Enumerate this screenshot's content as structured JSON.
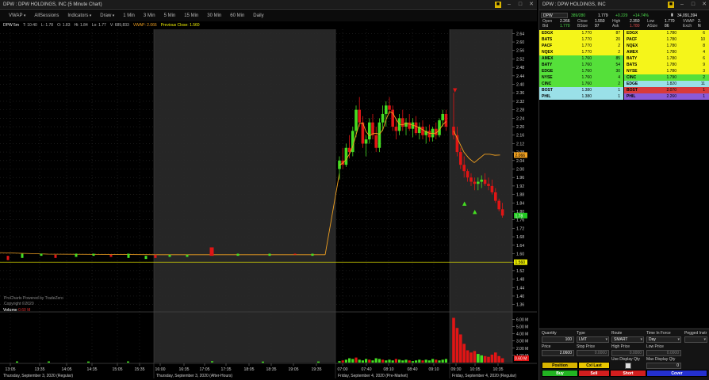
{
  "chart": {
    "title": "DPW : DPW HOLDINGS, INC (5 Minute Chart)",
    "toolbar": [
      "VWAP",
      "AllSessions",
      "Indicators",
      "Draw",
      "1 Min",
      "3 Min",
      "5 Min",
      "15 Min",
      "30 Min",
      "60 Min",
      "Daily"
    ],
    "info": {
      "symbol": "DPW 5m",
      "t": "T: 10:40",
      "l": "L: 1.78",
      "o": "O: 1.83",
      "hi": "Hi: 1.84",
      "lo": "Lo: 1.77",
      "v": "V: 689,833",
      "vwap": "VWAP: 2.066",
      "prev_close": "Previous Close: 1.560"
    },
    "watermark": [
      "ProCharts Powered by TradeZero",
      "Copyright ©2020"
    ],
    "volume_title": "Volume",
    "volume_value": "0.60 M",
    "colors": {
      "up": "#44dd22",
      "down": "#e01515",
      "vwap": "#f0a020",
      "prev_close": "#e8e800",
      "shade": "#262626"
    }
  },
  "chart_data": {
    "type": "candlestick",
    "price_ticks": [
      "2.64",
      "2.60",
      "2.56",
      "2.52",
      "2.48",
      "2.44",
      "2.40",
      "2.36",
      "2.32",
      "2.28",
      "2.24",
      "2.20",
      "2.16",
      "2.12",
      "2.08",
      "2.04",
      "2.00",
      "1.96",
      "1.92",
      "1.88",
      "1.84",
      "1.80",
      "1.76",
      "1.72",
      "1.68",
      "1.64",
      "1.60",
      "1.56",
      "1.52",
      "1.48",
      "1.44",
      "1.40",
      "1.36"
    ],
    "ylim": [
      1.34,
      2.66
    ],
    "volume_ticks": [
      "6.00 M",
      "5.00 M",
      "4.00 M",
      "3.00 M",
      "2.00 M",
      "1.00 M"
    ],
    "volume_ylim": [
      0,
      6.8
    ],
    "time_ticks": [
      "13:05",
      "13:35",
      "14:05",
      "14:35",
      "15:05",
      "15:35",
      "16:00",
      "16:35",
      "17:05",
      "17:35",
      "18:05",
      "18:35",
      "19:05",
      "19:35",
      "07:00",
      "07:40",
      "08:10",
      "08:40",
      "09:10",
      "09:30",
      "10:05",
      "10:35"
    ],
    "sessions": [
      "Thursday, September 3, 2020 (Regular)",
      "Thursday, September 3, 2020 (After-Hours)",
      "Friday, September 4, 2020 (Pre-Market)",
      "Friday, September 4, 2020 (Regular)"
    ],
    "price_markers": {
      "vwap": "2.066",
      "last": "1.78",
      "prev_close": "1.560"
    },
    "prev_close": 1.56,
    "candles_pre": [
      [
        2.0,
        2.06,
        1.95,
        2.04
      ],
      [
        2.04,
        2.1,
        2.0,
        2.02
      ],
      [
        2.02,
        2.12,
        2.01,
        2.1
      ],
      [
        2.1,
        2.16,
        2.05,
        2.08
      ],
      [
        2.08,
        2.2,
        2.06,
        2.18
      ],
      [
        2.18,
        2.3,
        2.15,
        2.28
      ],
      [
        2.28,
        2.34,
        2.2,
        2.22
      ],
      [
        2.22,
        2.25,
        2.1,
        2.12
      ],
      [
        2.12,
        2.16,
        2.06,
        2.14
      ],
      [
        2.14,
        2.24,
        2.12,
        2.22
      ],
      [
        2.22,
        2.26,
        2.14,
        2.16
      ],
      [
        2.16,
        2.2,
        2.08,
        2.1
      ],
      [
        2.1,
        2.24,
        2.08,
        2.22
      ],
      [
        2.22,
        2.3,
        2.18,
        2.26
      ],
      [
        2.26,
        2.32,
        2.2,
        2.3
      ],
      [
        2.3,
        2.34,
        2.26,
        2.28
      ],
      [
        2.28,
        2.3,
        2.18,
        2.2
      ],
      [
        2.2,
        2.24,
        2.14,
        2.18
      ],
      [
        2.18,
        2.26,
        2.16,
        2.24
      ],
      [
        2.24,
        2.28,
        2.18,
        2.2
      ],
      [
        2.2,
        2.24,
        2.16,
        2.22
      ],
      [
        2.22,
        2.26,
        2.18,
        2.19
      ],
      [
        2.19,
        2.24,
        2.15,
        2.22
      ],
      [
        2.22,
        2.25,
        2.16,
        2.17
      ],
      [
        2.17,
        2.22,
        2.14,
        2.2
      ],
      [
        2.2,
        2.23,
        2.14,
        2.16
      ],
      [
        2.16,
        2.2,
        2.12,
        2.18
      ],
      [
        2.18,
        2.21,
        2.13,
        2.15
      ],
      [
        2.15,
        2.2,
        2.13,
        2.19
      ],
      [
        2.19,
        2.22,
        2.14,
        2.16
      ],
      [
        2.16,
        2.24,
        2.15,
        2.23
      ],
      [
        2.23,
        2.28,
        2.2,
        2.26
      ],
      [
        2.26,
        2.28,
        2.18,
        2.2
      ]
    ],
    "candles_regular": [
      [
        2.2,
        2.36,
        2.14,
        2.16
      ],
      [
        2.16,
        2.2,
        2.06,
        2.08
      ],
      [
        2.08,
        2.1,
        2.0,
        2.02
      ],
      [
        2.02,
        2.06,
        1.96,
        1.99
      ],
      [
        1.99,
        2.0,
        1.94,
        1.96
      ],
      [
        1.96,
        1.98,
        1.92,
        1.94
      ],
      [
        1.94,
        1.96,
        1.9,
        1.93
      ],
      [
        1.93,
        1.96,
        1.9,
        1.94
      ],
      [
        1.94,
        1.97,
        1.91,
        1.95
      ],
      [
        1.95,
        1.98,
        1.92,
        1.93
      ],
      [
        1.93,
        1.96,
        1.9,
        1.92
      ],
      [
        1.92,
        1.95,
        1.88,
        1.89
      ],
      [
        1.89,
        1.91,
        1.84,
        1.85
      ],
      [
        1.85,
        1.86,
        1.8,
        1.81
      ],
      [
        1.81,
        1.84,
        1.77,
        1.78
      ]
    ],
    "volume_pre": [
      0.2,
      0.3,
      0.4,
      0.6,
      0.5,
      0.7,
      0.4,
      0.3,
      0.5,
      0.4,
      0.3,
      0.6,
      0.5,
      0.4,
      0.3,
      0.4,
      0.3,
      0.5,
      0.4,
      0.3,
      0.4,
      0.3,
      0.2,
      0.3,
      0.4,
      0.3,
      0.4,
      0.3,
      0.5,
      0.4,
      0.3,
      0.4,
      0.5
    ],
    "volume_regular": [
      6.2,
      4.8,
      3.9,
      2.6,
      1.7,
      1.4,
      1.6,
      1.2,
      1.0,
      0.9,
      0.8,
      1.1,
      1.4,
      0.9,
      0.6
    ]
  },
  "level2": {
    "title": "DPW : DPW HOLDINGS, INC",
    "symbol": "DPW",
    "range": "389/280",
    "last": "1.779",
    "change": "+0.229",
    "change_pct": "+14.74%",
    "volume": "34,091,394",
    "header": [
      [
        "Open",
        "2.266",
        "Close",
        "1.550",
        "High",
        "2.350",
        "Low",
        "1.770",
        "VWAP",
        "2."
      ],
      [
        "Bid",
        "1.770",
        "BSize",
        "97",
        "Ask",
        "1.780",
        "ASize",
        "86",
        "Exch",
        "N"
      ]
    ],
    "rows": [
      {
        "bmm": "EDGX",
        "bpx": "1.770",
        "bsz": "87",
        "amm": "EDGX",
        "apx": "1.780",
        "asz": "6",
        "bc": "#f5f51a",
        "ac": "#f5f51a"
      },
      {
        "bmm": "BATS",
        "bpx": "1.770",
        "bsz": "20",
        "amm": "PACF",
        "apx": "1.780",
        "asz": "10",
        "bc": "#f5f51a",
        "ac": "#f5f51a"
      },
      {
        "bmm": "PACF",
        "bpx": "1.770",
        "bsz": "2",
        "amm": "NQEX",
        "apx": "1.780",
        "asz": "8",
        "bc": "#f5f51a",
        "ac": "#f5f51a"
      },
      {
        "bmm": "NQEX",
        "bpx": "1.770",
        "bsz": "2",
        "amm": "AMEX",
        "apx": "1.780",
        "asz": "4",
        "bc": "#f5f51a",
        "ac": "#f5f51a"
      },
      {
        "bmm": "AMEX",
        "bpx": "1.760",
        "bsz": "85",
        "amm": "BATY",
        "apx": "1.780",
        "asz": "6",
        "bc": "#55e03a",
        "ac": "#f5f51a"
      },
      {
        "bmm": "BATY",
        "bpx": "1.760",
        "bsz": "54",
        "amm": "BATS",
        "apx": "1.780",
        "asz": "9",
        "bc": "#55e03a",
        "ac": "#f5f51a"
      },
      {
        "bmm": "EDGE",
        "bpx": "1.760",
        "bsz": "30",
        "amm": "NYSE",
        "apx": "1.780",
        "asz": "3",
        "bc": "#55e03a",
        "ac": "#f5f51a"
      },
      {
        "bmm": "NYSE",
        "bpx": "1.760",
        "bsz": "4",
        "amm": "CINC",
        "apx": "1.790",
        "asz": "2",
        "bc": "#55e03a",
        "ac": "#55e03a"
      },
      {
        "bmm": "CINC",
        "bpx": "1.760",
        "bsz": "2",
        "amm": "EDGE",
        "apx": "1.820",
        "asz": "11",
        "bc": "#55e03a",
        "ac": "#9ae0e8"
      },
      {
        "bmm": "BOST",
        "bpx": "1.380",
        "bsz": "1",
        "amm": "BOST",
        "apx": "2.070",
        "asz": "1",
        "bc": "#9ae0e8",
        "ac": "#d83a3a"
      },
      {
        "bmm": "PHIL",
        "bpx": "1.380",
        "bsz": "1",
        "amm": "PHIL",
        "apx": "2.260",
        "asz": "1",
        "bc": "#9ae0e8",
        "ac": "#8a5ad8"
      }
    ]
  },
  "order": {
    "labels": {
      "quantity": "Quantity",
      "type": "Type",
      "route": "Route",
      "tif": "Time In Force",
      "pegged": "Pegged Instr",
      "price": "Price",
      "stop_price": "Stop Price",
      "high_price": "High Price",
      "low_price": "Low Price",
      "use_display_qty": "Use Display Qty",
      "max_display_qty": "Max Display Qty"
    },
    "values": {
      "quantity": "100",
      "type": "LMT",
      "route": "SMART",
      "tif": "Day",
      "price": "2.0600",
      "stop_price": "0.0000",
      "high_price": "0.0000",
      "low_price": "0.0000",
      "max_display_qty": "0"
    },
    "buttons": {
      "position": "Position",
      "cxl_last": "Cxl Last",
      "buy": "Buy",
      "sell": "Sell",
      "short": "Short",
      "cover": "Cover"
    }
  }
}
